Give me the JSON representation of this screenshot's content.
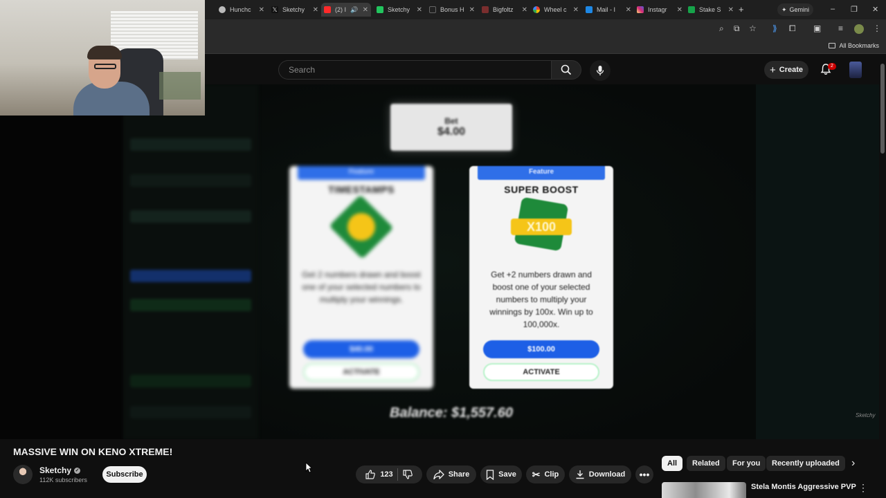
{
  "browser": {
    "tabs": [
      {
        "label": "Hunchc",
        "color": "#bbbbbb"
      },
      {
        "label": "Sketchy",
        "color": "#dddddd"
      },
      {
        "label": "(2) I",
        "color": "#ff2a2a"
      },
      {
        "label": "Sketchy",
        "color": "#22c55e"
      },
      {
        "label": "Bonus H",
        "color": "#222222"
      },
      {
        "label": "Bigfoltz",
        "color": "#7a2e2e"
      },
      {
        "label": "Wheel c",
        "color": "#4285f4"
      },
      {
        "label": "Mail - I",
        "color": "#1e88e5"
      },
      {
        "label": "Instagr",
        "color": "#e1306c"
      },
      {
        "label": "Stake S",
        "color": "#16a34a"
      }
    ],
    "gemini_label": "Gemini",
    "all_bookmarks": "All Bookmarks"
  },
  "youtube": {
    "search_placeholder": "Search",
    "create_label": "Create",
    "notification_count": "2"
  },
  "player": {
    "bet_line1": "Bet",
    "bet_line2": "$4.00",
    "card_left": {
      "tag": "Feature",
      "title": "TIMESTAMPS",
      "description": "Get 2 numbers drawn and boost one of your selected numbers to multiply your winnings.",
      "price": "$40.00",
      "action": "ACTIVATE"
    },
    "card_right": {
      "tag": "Feature",
      "title": "SUPER BOOST",
      "art_text": "X100",
      "description": "Get +2 numbers drawn and boost one of your selected numbers to multiply your winnings by 100x. Win up to 100,000x.",
      "price": "$100.00",
      "action": "ACTIVATE"
    },
    "balance": "Balance: $1,557.60",
    "watermark": "Sketchy"
  },
  "video": {
    "title": "MASSIVE WIN ON KENO XTREME!",
    "channel_name": "Sketchy",
    "subscribers": "112K subscribers",
    "subscribe_label": "Subscribe",
    "like_count": "123",
    "share_label": "Share",
    "save_label": "Save",
    "clip_label": "Clip",
    "download_label": "Download"
  },
  "chips": [
    "All",
    "Related",
    "For you",
    "Recently uploaded"
  ],
  "recommendation": {
    "title": "Stela Montis Aggressive PVP"
  },
  "colors": {
    "accent_blue": "#1d5fe6",
    "feature_tag": "#2f6fe8",
    "youtube_red": "#cc0000"
  }
}
